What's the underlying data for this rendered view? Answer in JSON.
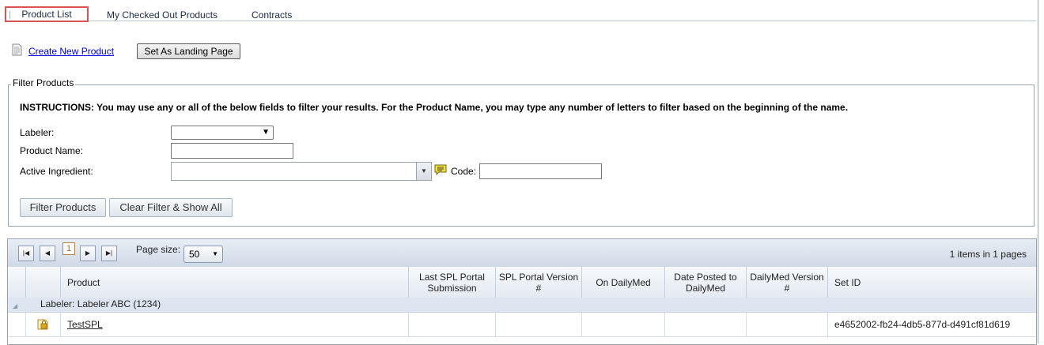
{
  "tabs": [
    {
      "label": "Product List",
      "active": true
    },
    {
      "label": "My Checked Out Products",
      "active": false
    },
    {
      "label": "Contracts",
      "active": false
    }
  ],
  "toolbar": {
    "create_link": "Create New Product",
    "create_icon": "document-icon",
    "landing_button": "Set As Landing Page"
  },
  "filter": {
    "legend": "Filter Products",
    "instructions": "INSTRUCTIONS: You may use any or all of the below fields to filter your results. For the Product Name, you may type any number of letters to filter based on the beginning of the name.",
    "labeler_label": "Labeler:",
    "labeler_value": "",
    "product_name_label": "Product Name:",
    "product_name_value": "",
    "active_ingredient_label": "Active Ingredient:",
    "active_ingredient_value": "",
    "code_label": "Code:",
    "code_value": "",
    "filter_button": "Filter Products",
    "clear_button": "Clear Filter & Show All"
  },
  "pager": {
    "current_page": "1",
    "page_size_label": "Page size:",
    "page_size": "50",
    "info": "1 items in 1 pages"
  },
  "grid": {
    "columns": [
      "Product",
      "Last SPL Portal Submission",
      "SPL Portal Version #",
      "On DailyMed",
      "Date Posted to DailyMed",
      "DailyMed Version #",
      "Set ID"
    ],
    "group_label": "Labeler: Labeler ABC (1234)",
    "rows": [
      {
        "product": "TestSPL",
        "last_submission": "",
        "portal_version": "",
        "on_dailymed": "",
        "date_posted": "",
        "dailymed_version": "",
        "set_id": "e4652002-fb24-4db5-877d-d491cf81d619"
      }
    ]
  },
  "colors": {
    "active_tab_border": "#d9534f",
    "link": "#0000ee",
    "grid_header": "#e4eaf1",
    "group_row": "#dde6f0"
  }
}
